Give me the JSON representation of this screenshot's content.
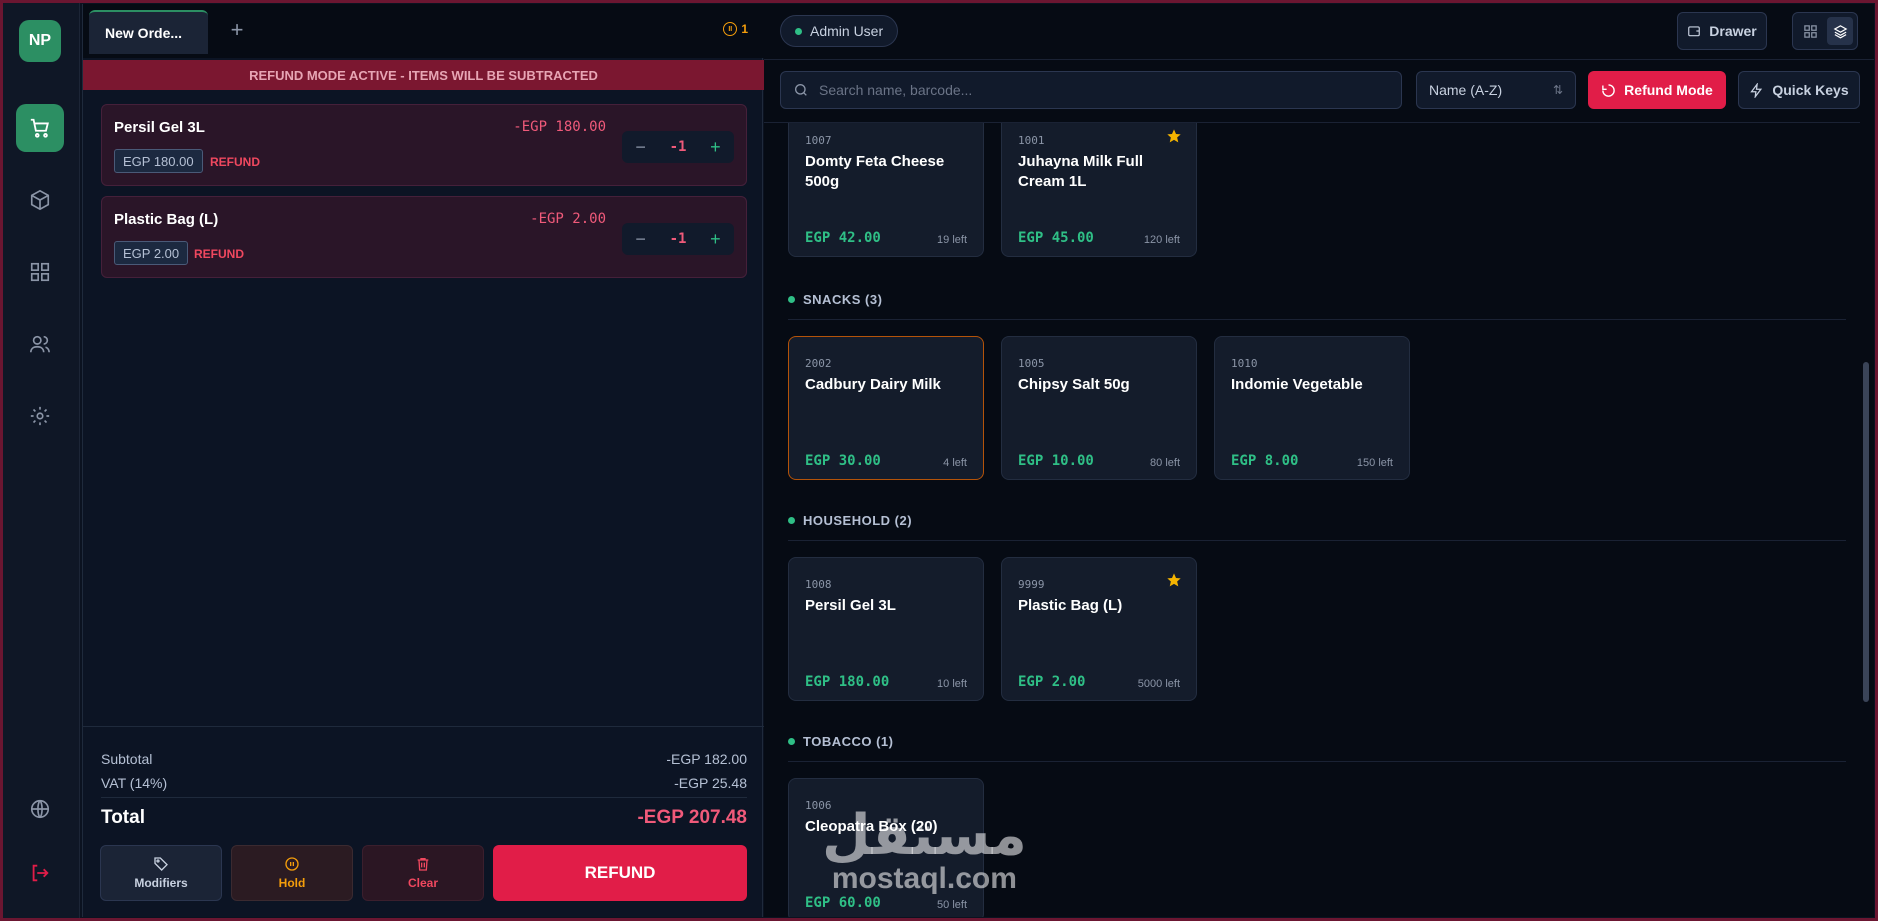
{
  "nav": {
    "avatar": "NP",
    "items": [
      "cart",
      "products",
      "dashboard",
      "customers",
      "settings"
    ],
    "bottom": [
      "language",
      "logout"
    ]
  },
  "cart": {
    "tab_label": "New Orde...",
    "held_count": "1",
    "banner": "REFUND MODE ACTIVE - ITEMS WILL BE SUBTRACTED",
    "items": [
      {
        "name": "Persil Gel 3L",
        "line_total": "-EGP 180.00",
        "unit_price": "EGP 180.00",
        "tag": "REFUND",
        "qty": "-1"
      },
      {
        "name": "Plastic Bag (L)",
        "line_total": "-EGP 2.00",
        "unit_price": "EGP 2.00",
        "tag": "REFUND",
        "qty": "-1"
      }
    ],
    "subtotal_label": "Subtotal",
    "subtotal": "-EGP 182.00",
    "vat_label": "VAT (14%)",
    "vat": "-EGP 25.48",
    "total_label": "Total",
    "total": "-EGP 207.48",
    "actions": {
      "modifiers": "Modifiers",
      "hold": "Hold",
      "clear": "Clear",
      "refund": "REFUND"
    }
  },
  "header": {
    "user": "Admin User",
    "drawer": "Drawer",
    "search_placeholder": "Search name, barcode...",
    "sort": "Name (A-Z)",
    "refund_mode": "Refund Mode",
    "quick_keys": "Quick Keys"
  },
  "catalog": {
    "top_items": [
      {
        "sku": "1007",
        "name": "Domty Feta Cheese 500g",
        "price": "EGP 42.00",
        "stock": "19 left",
        "favorite": false
      },
      {
        "sku": "1001",
        "name": "Juhayna Milk Full Cream 1L",
        "price": "EGP 45.00",
        "stock": "120 left",
        "favorite": true
      }
    ],
    "snacks": {
      "title": "SNACKS (3)",
      "items": [
        {
          "sku": "2002",
          "name": "Cadbury Dairy Milk",
          "price": "EGP 30.00",
          "stock": "4 left",
          "favorite": false
        },
        {
          "sku": "1005",
          "name": "Chipsy Salt 50g",
          "price": "EGP 10.00",
          "stock": "80 left",
          "favorite": false
        },
        {
          "sku": "1010",
          "name": "Indomie Vegetable",
          "price": "EGP 8.00",
          "stock": "150 left",
          "favorite": false
        }
      ]
    },
    "household": {
      "title": "HOUSEHOLD (2)",
      "items": [
        {
          "sku": "1008",
          "name": "Persil Gel 3L",
          "price": "EGP 180.00",
          "stock": "10 left",
          "favorite": false
        },
        {
          "sku": "9999",
          "name": "Plastic Bag (L)",
          "price": "EGP 2.00",
          "stock": "5000 left",
          "favorite": true
        }
      ]
    },
    "tobacco": {
      "title": "TOBACCO (1)",
      "items": [
        {
          "sku": "1006",
          "name": "Cleopatra Box (20)",
          "price": "EGP 60.00",
          "stock": "50 left",
          "favorite": false
        }
      ]
    }
  },
  "watermark": {
    "arabic": "مستقل",
    "latin": "mostaql.com"
  },
  "colors": {
    "accent": "#2c8f63",
    "danger": "#e11d48",
    "price_green": "#2fbf86",
    "warning": "#f59e0b"
  }
}
